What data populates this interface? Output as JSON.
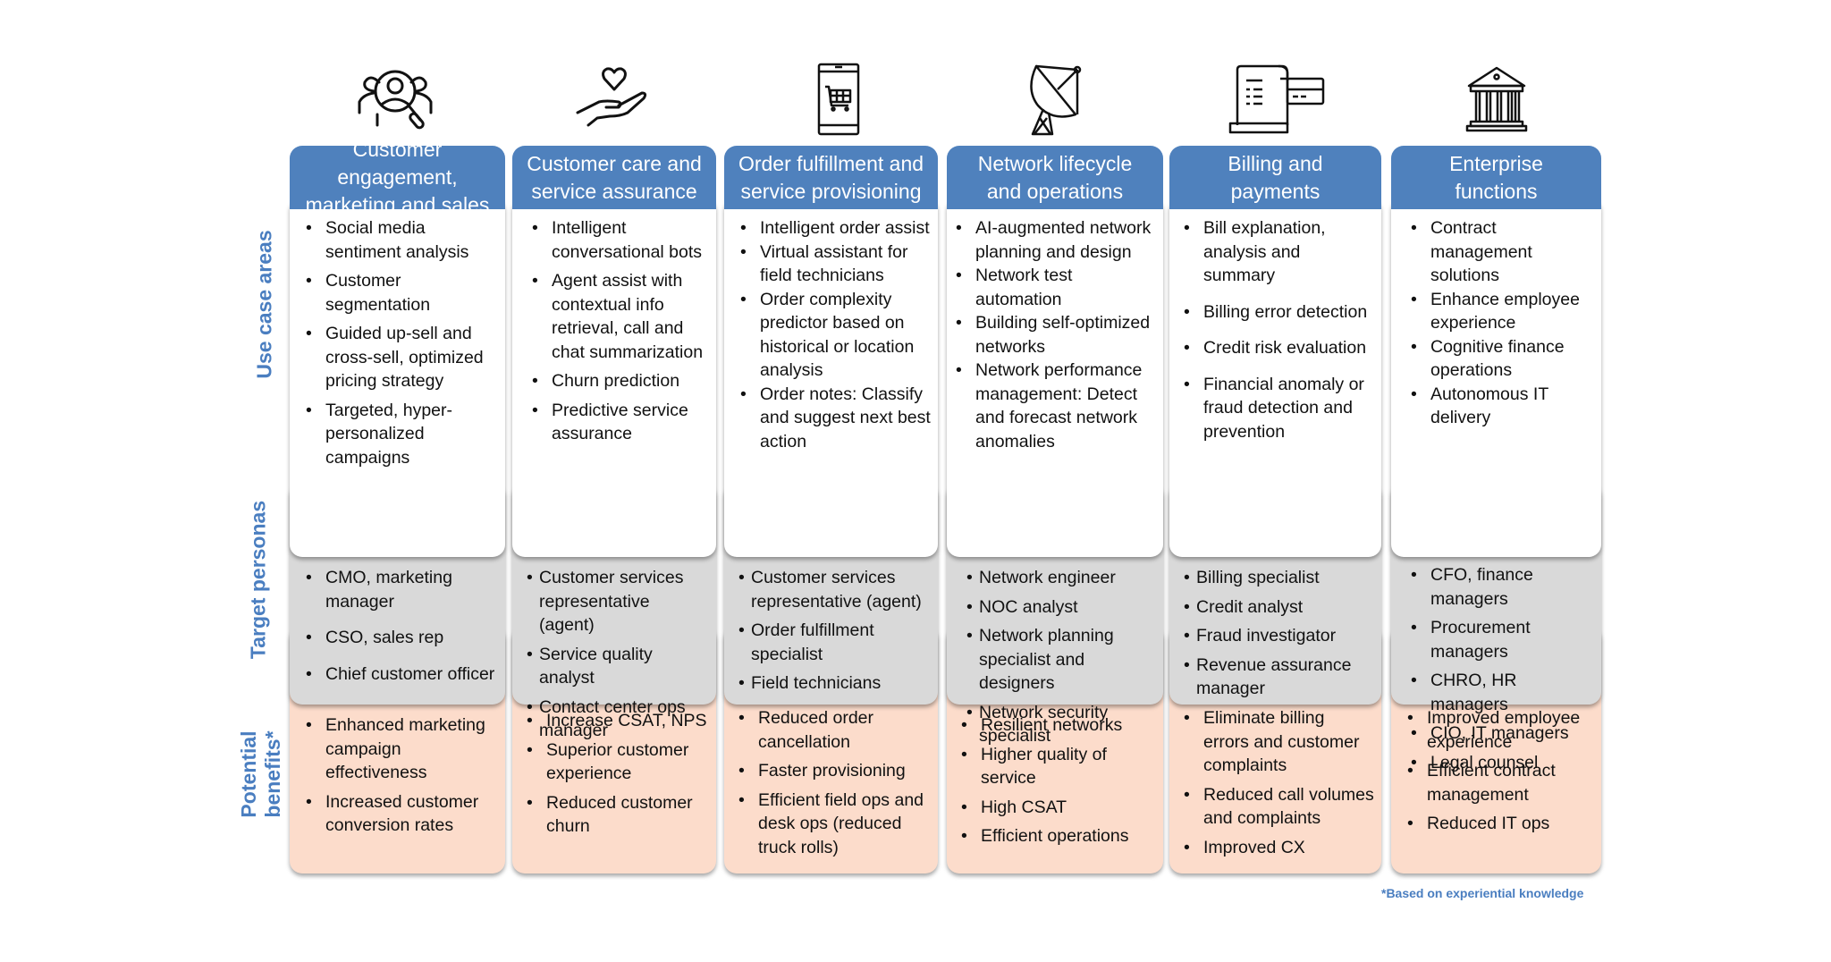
{
  "row_labels": {
    "use_cases": "Use case areas",
    "personas": "Target personas",
    "benefits_line1": "Potential",
    "benefits_line2": "benefits*"
  },
  "colors": {
    "header": "#4F81BD",
    "use_cases_bg": "#FFFFFF",
    "personas_bg": "#D9D9D9",
    "benefits_bg": "#FCDCCB",
    "label_text": "#4A7EC0"
  },
  "columns": [
    {
      "icon": "people-search-icon",
      "title_line1": "Customer engagement,",
      "title_line2": "marketing and sales",
      "use_cases": [
        "Social media sentiment analysis",
        "Customer segmentation",
        "Guided up-sell and cross-sell, optimized pricing strategy",
        "Targeted, hyper-personalized campaigns"
      ],
      "personas": [
        "CMO, marketing manager",
        "CSO, sales rep",
        "Chief customer officer"
      ],
      "benefits": [
        "Enhanced marketing campaign effectiveness",
        "Increased customer conversion rates"
      ]
    },
    {
      "icon": "hand-heart-icon",
      "title_line1": "Customer care and",
      "title_line2": "service assurance",
      "use_cases": [
        "Intelligent conversational bots",
        "Agent assist with contextual info retrieval, call and chat summarization",
        "Churn prediction",
        "Predictive service assurance"
      ],
      "personas": [
        "Customer services representative (agent)",
        "Service quality analyst",
        "Contact center ops manager"
      ],
      "benefits": [
        "Increase CSAT, NPS",
        "Superior customer experience",
        "Reduced customer churn"
      ]
    },
    {
      "icon": "mobile-cart-icon",
      "title_line1": "Order fulfillment and",
      "title_line2": "service provisioning",
      "use_cases": [
        "Intelligent order assist",
        "Virtual assistant for field technicians",
        "Order complexity predictor based on historical or location analysis",
        "Order notes: Classify and suggest next best action"
      ],
      "personas": [
        "Customer services representative (agent)",
        "Order fulfillment specialist",
        "Field technicians"
      ],
      "benefits": [
        "Reduced order cancellation",
        "Faster provisioning",
        "Efficient field ops and desk ops (reduced truck rolls)"
      ]
    },
    {
      "icon": "satellite-dish-icon",
      "title_line1": "Network lifecycle",
      "title_line2": "and operations",
      "use_cases": [
        "AI-augmented network planning and design",
        "Network test automation",
        "Building self-optimized networks",
        "Network performance management: Detect and forecast network anomalies"
      ],
      "personas": [
        "Network engineer",
        "NOC analyst",
        "Network planning specialist and designers",
        "Network security specialist"
      ],
      "benefits": [
        "Resilient networks",
        "Higher quality of service",
        "High CSAT",
        "Efficient operations"
      ]
    },
    {
      "icon": "receipt-card-icon",
      "title_line1": "Billing and",
      "title_line2": "payments",
      "use_cases": [
        "Bill explanation, analysis and summary",
        "Billing error detection",
        "Credit risk evaluation",
        "Financial anomaly or fraud detection and prevention"
      ],
      "personas": [
        "Billing specialist",
        "Credit analyst",
        "Fraud investigator",
        "Revenue assurance manager"
      ],
      "benefits": [
        "Eliminate billing errors and customer complaints",
        "Reduced call volumes and complaints",
        "Improved CX"
      ]
    },
    {
      "icon": "bank-building-icon",
      "title_line1": "Enterprise",
      "title_line2": "functions",
      "use_cases": [
        "Contract management solutions",
        "Enhance employee experience",
        "Cognitive finance operations",
        "Autonomous IT delivery"
      ],
      "personas": [
        "CFO, finance managers",
        "Procurement managers",
        "CHRO, HR managers",
        "CIO, IT managers",
        "Legal counsel"
      ],
      "benefits": [
        "Improved employee experience",
        "Efficient contract management",
        "Reduced IT ops"
      ]
    }
  ],
  "footnote": "*Based on experiential knowledge"
}
